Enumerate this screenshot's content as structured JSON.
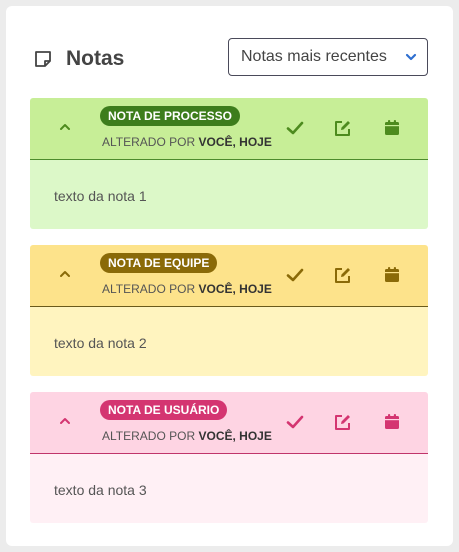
{
  "header": {
    "title": "Notas",
    "sort_selected": "Notas mais recentes"
  },
  "notes": [
    {
      "badge": "NOTA DE PROCESSO",
      "meta_prefix": "ALTERADO POR",
      "meta_author": "VOCÊ, HOJE",
      "text": "texto da nota 1",
      "accent": "#3d7d1c",
      "icon_color": "#4d8b1e"
    },
    {
      "badge": "NOTA DE EQUIPE",
      "meta_prefix": "ALTERADO POR",
      "meta_author": "VOCÊ, HOJE",
      "text": "texto da nota 2",
      "accent": "#8a6a08",
      "icon_color": "#8a6a08"
    },
    {
      "badge": "NOTA DE USUÁRIO",
      "meta_prefix": "ALTERADO POR",
      "meta_author": "VOCÊ, HOJE",
      "text": "texto da nota 3",
      "accent": "#d43571",
      "icon_color": "#d43571"
    }
  ],
  "icons": {
    "title": "note-icon",
    "sort": "chevron-down-icon",
    "collapse": "chevron-up-icon",
    "actions": [
      "check-icon",
      "edit-icon",
      "calendar-icon"
    ]
  },
  "colors": {
    "select_chevron": "#2f6fd0"
  }
}
